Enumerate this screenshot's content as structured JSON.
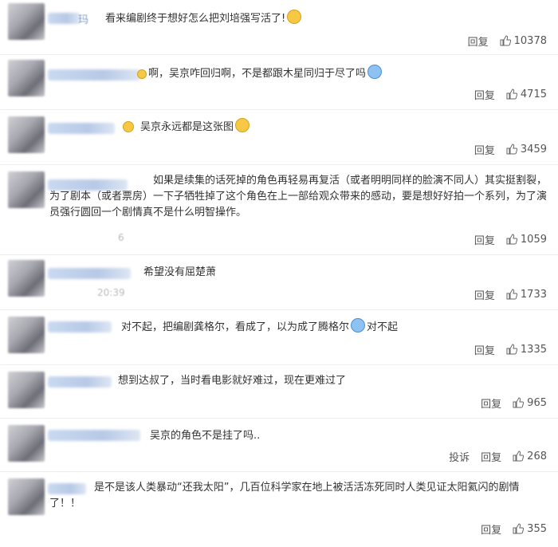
{
  "comments": [
    {
      "text": "看来编剧终于想好怎么把刘培强写活了!",
      "emoji": "yellow",
      "reply": "回复",
      "likes": "10378"
    },
    {
      "text": "啊，吴京咋回归啊，不是都跟木星同归于尽了吗",
      "emoji": "blue",
      "reply": "回复",
      "likes": "4715"
    },
    {
      "text": "吴京永远都是这张图",
      "emoji": "yellow",
      "reply": "回复",
      "likes": "3459"
    },
    {
      "text": "如果是续集的话死掉的角色再轻易再复活（或者明明同样的脸演不同人）其实挺割裂，为了剧本（或者票房）一下子牺牲掉了这个角色在上一部给观众带来的感动，要是想好好拍一个系列，为了演员强行圆回一个剧情真不是什么明智操作。",
      "reply": "回复",
      "likes": "1059"
    },
    {
      "text": "希望没有屈楚萧",
      "time_fragment": "20:39",
      "reply": "回复",
      "likes": "1733"
    },
    {
      "text_before": "对不起，把编剧龚格尔，看成了，以为成了腾格尔",
      "text_after": "对不起",
      "emoji": "blue",
      "reply": "回复",
      "likes": "1335"
    },
    {
      "text": "想到达叔了，当时看电影就好难过，现在更难过了",
      "reply": "回复",
      "likes": "965"
    },
    {
      "text": "吴京的角色不是挂了吗..",
      "report": "投诉",
      "reply": "回复",
      "likes": "268"
    },
    {
      "text": "是不是该人类暴动“还我太阳”，几百位科学家在地上被活活冻死同时人类见证太阳氦闪的剧情了！！",
      "reply": "回复",
      "likes": "355"
    }
  ],
  "partial_name": "玛",
  "partial_time_digit": "6"
}
